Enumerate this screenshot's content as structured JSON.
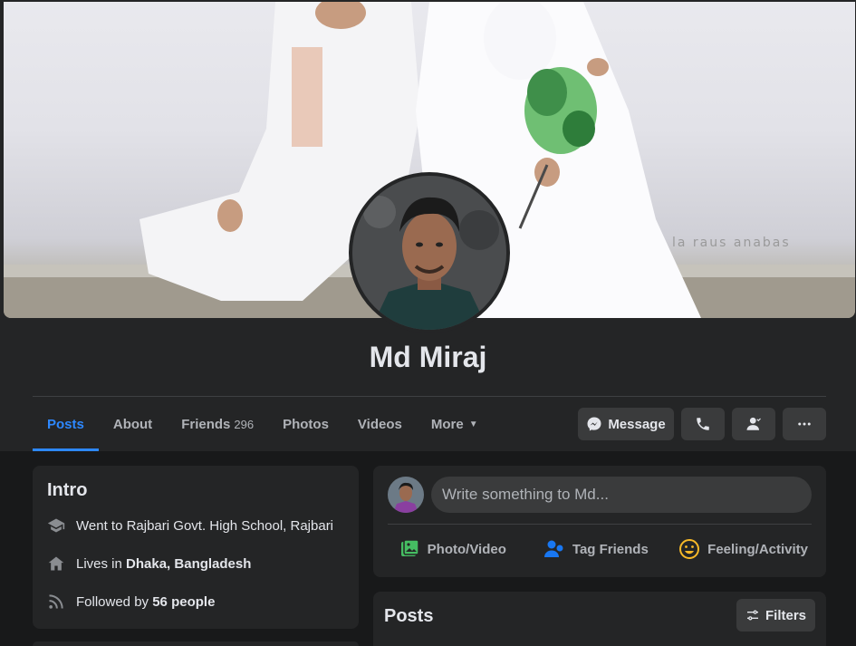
{
  "profile": {
    "name": "Md Miraj",
    "cover_watermark": "la raus anabas"
  },
  "tabs": [
    {
      "label": "Posts",
      "active": true
    },
    {
      "label": "About"
    },
    {
      "label": "Friends",
      "count": "296"
    },
    {
      "label": "Photos"
    },
    {
      "label": "Videos"
    },
    {
      "label": "More"
    }
  ],
  "actions": {
    "message_label": "Message"
  },
  "intro": {
    "title": "Intro",
    "education": "Went to Rajbari Govt. High School, Rajbari",
    "lives_prefix": "Lives in ",
    "lives_place": "Dhaka, Bangladesh",
    "followed_prefix": "Followed by ",
    "followed_count": "56 people"
  },
  "composer": {
    "placeholder": "Write something to Md...",
    "photo_video": "Photo/Video",
    "tag_friends": "Tag Friends",
    "feeling_activity": "Feeling/Activity"
  },
  "posts": {
    "title": "Posts",
    "filters_label": "Filters"
  },
  "colors": {
    "accent": "#2d88ff",
    "background": "#18191a",
    "card": "#242526",
    "button": "#3a3b3c",
    "photo_icon": "#45bd62",
    "tag_icon": "#1877f2",
    "feeling_icon": "#f7b928"
  },
  "icons": [
    "messenger-icon",
    "phone-icon",
    "person-icon",
    "more-icon",
    "graduation-cap-icon",
    "home-icon",
    "rss-icon",
    "photo-icon",
    "tag-friends-icon",
    "smiley-icon",
    "filters-icon"
  ]
}
